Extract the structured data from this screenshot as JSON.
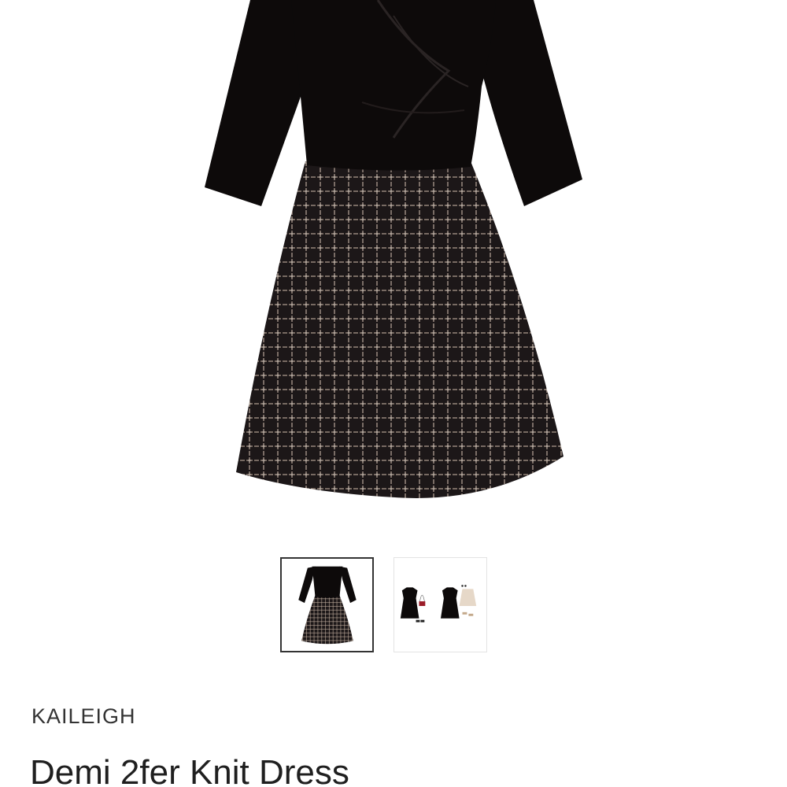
{
  "product": {
    "brand": "KAILEIGH",
    "name": "Demi 2fer Knit Dress"
  },
  "gallery": {
    "selected_index": 0,
    "thumbnails": [
      {
        "label": "dress-front-view"
      },
      {
        "label": "styled-outfits-view"
      }
    ]
  },
  "colors": {
    "bodice": "#0d0a0a",
    "skirt": "#1c1718",
    "plaid": "#c7b3a3",
    "selected_border": "#333333",
    "thumb_border": "#e3e3e3",
    "text": "#1f1f1f"
  }
}
